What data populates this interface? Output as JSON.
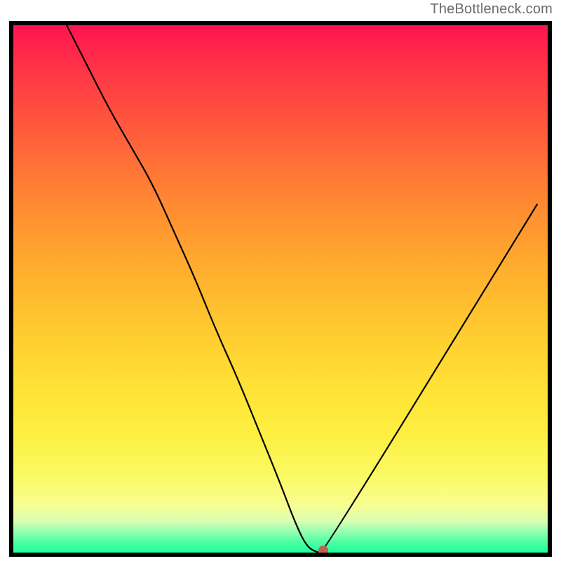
{
  "attribution": "TheBottleneck.com",
  "colors": {
    "frame": "#000000",
    "curve": "#000000",
    "marker": "#c36250",
    "gradient_top": "#ff1450",
    "gradient_bottom": "#1dff9b"
  },
  "chart_data": {
    "type": "line",
    "title": "",
    "xlabel": "",
    "ylabel": "",
    "xlim": [
      0,
      100
    ],
    "ylim": [
      0,
      100
    ],
    "x": [
      10,
      14,
      18,
      22,
      26,
      30,
      34,
      38,
      42,
      46,
      50,
      53,
      55,
      57,
      58,
      98
    ],
    "values": [
      100,
      92,
      84,
      77,
      70,
      61,
      52,
      42,
      33,
      23,
      13,
      5,
      1,
      0,
      0,
      66
    ],
    "annotations": [
      {
        "type": "marker",
        "x": 58,
        "y": 0,
        "label": ""
      }
    ]
  }
}
